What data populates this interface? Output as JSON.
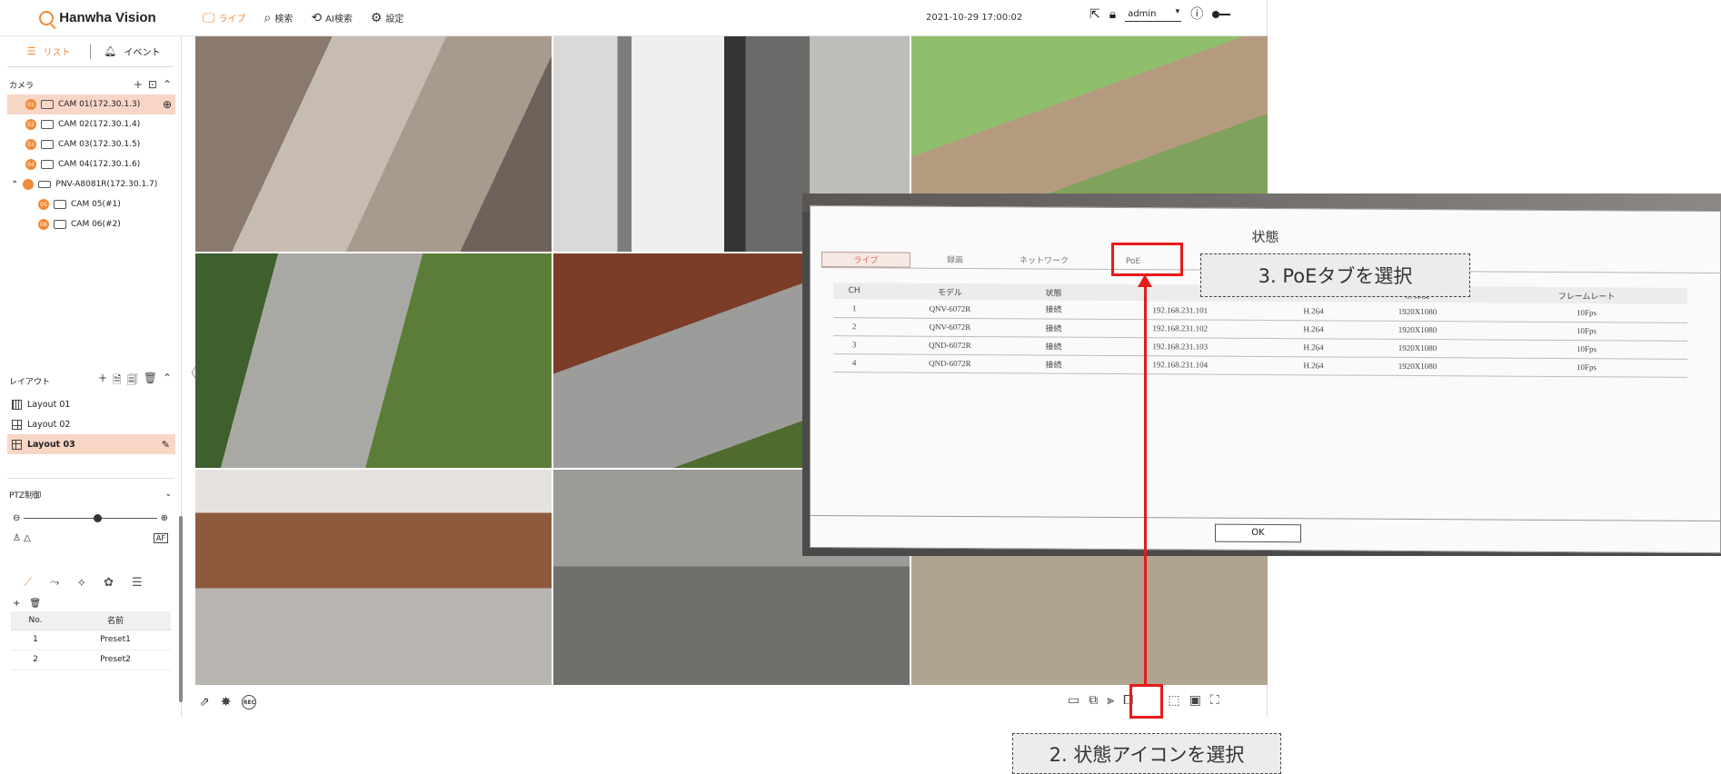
{
  "header": {
    "brand": "Hanwha Vision",
    "nav": [
      {
        "label": "ライブ",
        "icon": "monitor-icon",
        "active": true
      },
      {
        "label": "検索",
        "icon": "search-icon"
      },
      {
        "label": "AI検索",
        "icon": "ai-search-icon"
      },
      {
        "label": "設定",
        "icon": "gear-icon"
      }
    ],
    "datetime": "2021-10-29 17:00:02",
    "user": "admin"
  },
  "sidebar": {
    "tabs": [
      {
        "label": "リスト"
      },
      {
        "label": "イベント"
      }
    ],
    "camera_section": "カメラ",
    "cameras": [
      {
        "ch": "01",
        "label": "CAM 01(172.30.1.3)",
        "selected": true
      },
      {
        "ch": "02",
        "label": "CAM 02(172.30.1.4)"
      },
      {
        "ch": "03",
        "label": "CAM 03(172.30.1.5)"
      },
      {
        "ch": "04",
        "label": "CAM 04(172.30.1.6)"
      },
      {
        "ch": "",
        "label": "PNV-A8081R(172.30.1.7)"
      },
      {
        "ch": "05",
        "label": "CAM 05(#1)"
      },
      {
        "ch": "06",
        "label": "CAM 06(#2)"
      }
    ],
    "layout_section": "レイアウト",
    "layouts": [
      {
        "label": "Layout 01"
      },
      {
        "label": "Layout 02"
      },
      {
        "label": "Layout 03",
        "selected": true
      }
    ],
    "ptz_section": "PTZ制御",
    "zoom_level": 0.55,
    "preset_table": {
      "headers": [
        "No.",
        "名前"
      ],
      "rows": [
        [
          "1",
          "Preset1"
        ],
        [
          "2",
          "Preset2"
        ]
      ]
    }
  },
  "status_dialog": {
    "title": "状態",
    "tabs": [
      "ライブ",
      "録画",
      "ネットワーク",
      "PoE"
    ],
    "active_tab": "ライブ",
    "columns": [
      "CH",
      "モデル",
      "状態",
      "",
      "",
      "解像度",
      "フレームレート"
    ],
    "rows": [
      [
        "1",
        "QNV-6072R",
        "接続",
        "192.168.231.101",
        "H.264",
        "1920X1080",
        "10Fps"
      ],
      [
        "2",
        "QNV-6072R",
        "接続",
        "192.168.231.102",
        "H.264",
        "1920X1080",
        "10Fps"
      ],
      [
        "3",
        "QND-6072R",
        "接続",
        "192.168.231.103",
        "H.264",
        "1920X1080",
        "10Fps"
      ],
      [
        "4",
        "QND-6072R",
        "接続",
        "192.168.231.104",
        "H.264",
        "1920X1080",
        "10Fps"
      ]
    ],
    "ok_label": "OK"
  },
  "annotations": {
    "step3": "3. PoEタブを選択",
    "step2": "2. 状態アイコンを選択"
  },
  "colors": {
    "accent": "#f08a38",
    "highlight": "#e81a1a",
    "selected_bg": "#f8d6c6"
  }
}
